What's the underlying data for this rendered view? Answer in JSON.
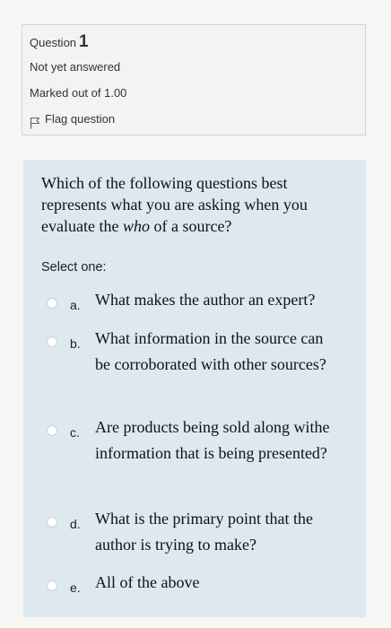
{
  "info": {
    "question_label": "Question",
    "question_number": "1",
    "status": "Not yet answered",
    "marks": "Marked out of 1.00",
    "flag_label": "Flag question"
  },
  "question": {
    "text_before": "Which of the following questions best represents what you are asking when you evaluate the ",
    "text_emphasis": "who",
    "text_after": " of a source?",
    "prompt": "Select one:",
    "options": [
      {
        "letter": "a.",
        "text": "What makes the author an expert?"
      },
      {
        "letter": "b.",
        "text": "What information in the source can be corroborated with other sources?"
      },
      {
        "letter": "c.",
        "text": "Are products being sold along withe information that is being presented?"
      },
      {
        "letter": "d.",
        "text": "What is the primary point that the author is trying to make?"
      },
      {
        "letter": "e.",
        "text": "All of the above"
      }
    ]
  },
  "colors": {
    "info_background": "#f3f3f3",
    "content_background": "#dde8ef",
    "page_background": "#f6f6f4"
  },
  "icons": {
    "flag": "flag-icon",
    "radio": "radio-button"
  }
}
